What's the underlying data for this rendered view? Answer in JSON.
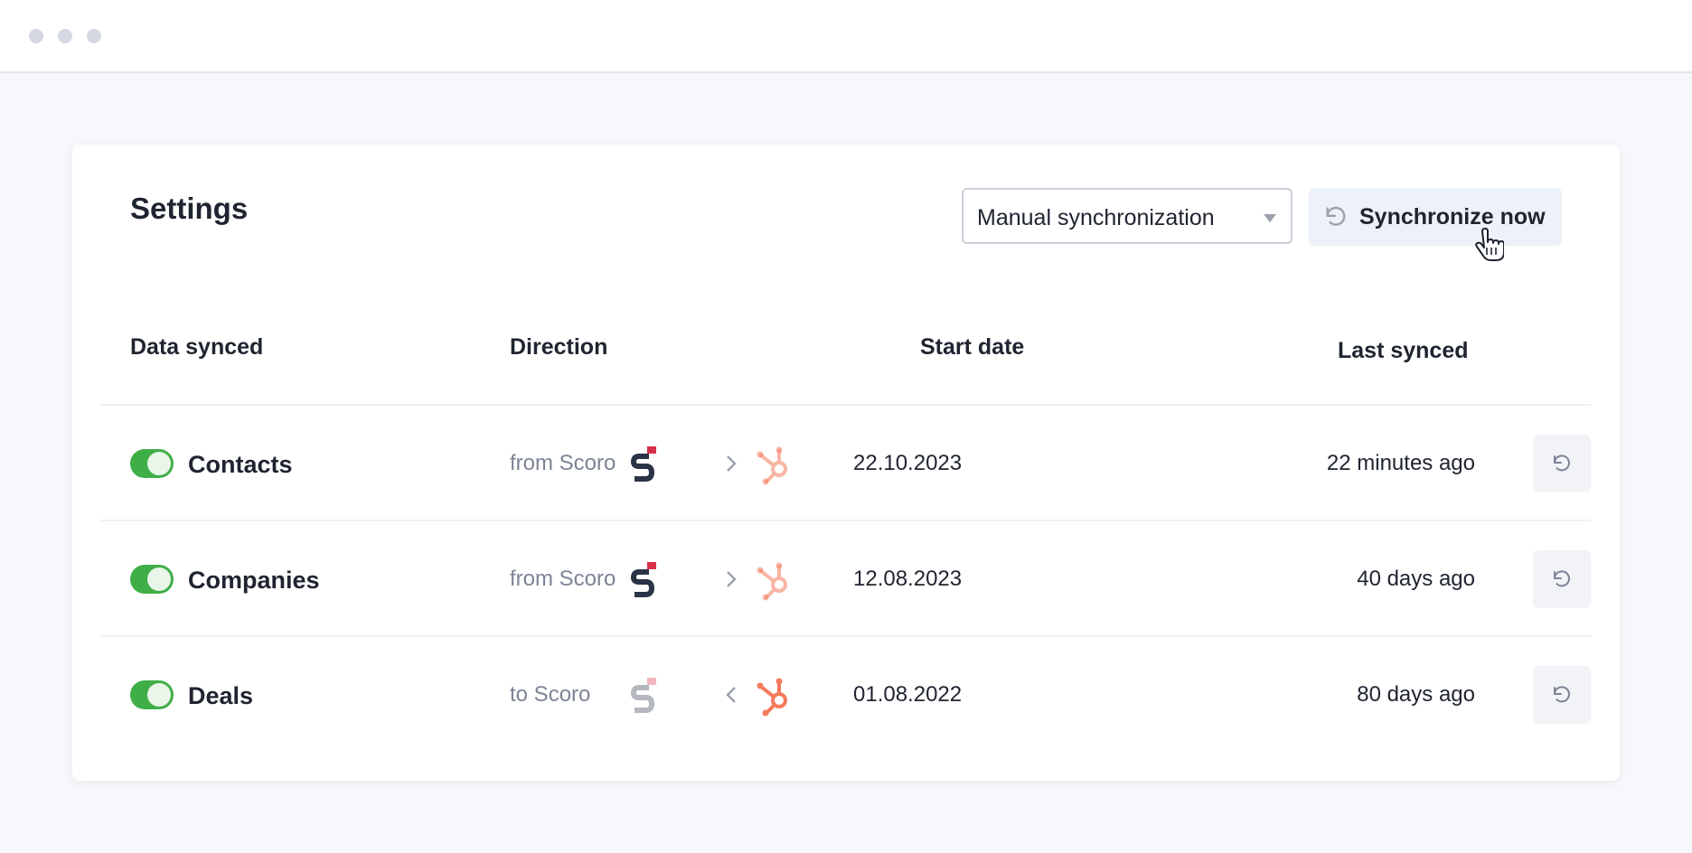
{
  "window": {
    "controls": [
      "close",
      "minimize",
      "maximize"
    ]
  },
  "settings": {
    "title": "Settings",
    "sync_mode": {
      "value": "Manual synchronization",
      "icon": "chevron-down-icon"
    },
    "sync_now_label": "Synchronize now"
  },
  "table": {
    "headers": {
      "data_synced": "Data synced",
      "direction": "Direction",
      "start_date": "Start date",
      "last_synced": "Last synced"
    },
    "rows": [
      {
        "name": "Contacts",
        "enabled": true,
        "direction": "from Scoro",
        "arrow": ">",
        "start_date": "22.10.2023",
        "last_synced": "22 minutes ago"
      },
      {
        "name": "Companies",
        "enabled": true,
        "direction": "from Scoro",
        "arrow": ">",
        "start_date": "12.08.2023",
        "last_synced": "40 days ago"
      },
      {
        "name": "Deals",
        "enabled": true,
        "direction": "to Scoro",
        "arrow": "<",
        "start_date": "01.08.2022",
        "last_synced": "80 days ago"
      }
    ]
  },
  "colors": {
    "toggle_on": "#3fae47",
    "scoro_dark": "#2b3347",
    "scoro_red": "#d9304a",
    "hubspot_orange": "#f47b5c",
    "muted_text": "#7d8496"
  }
}
